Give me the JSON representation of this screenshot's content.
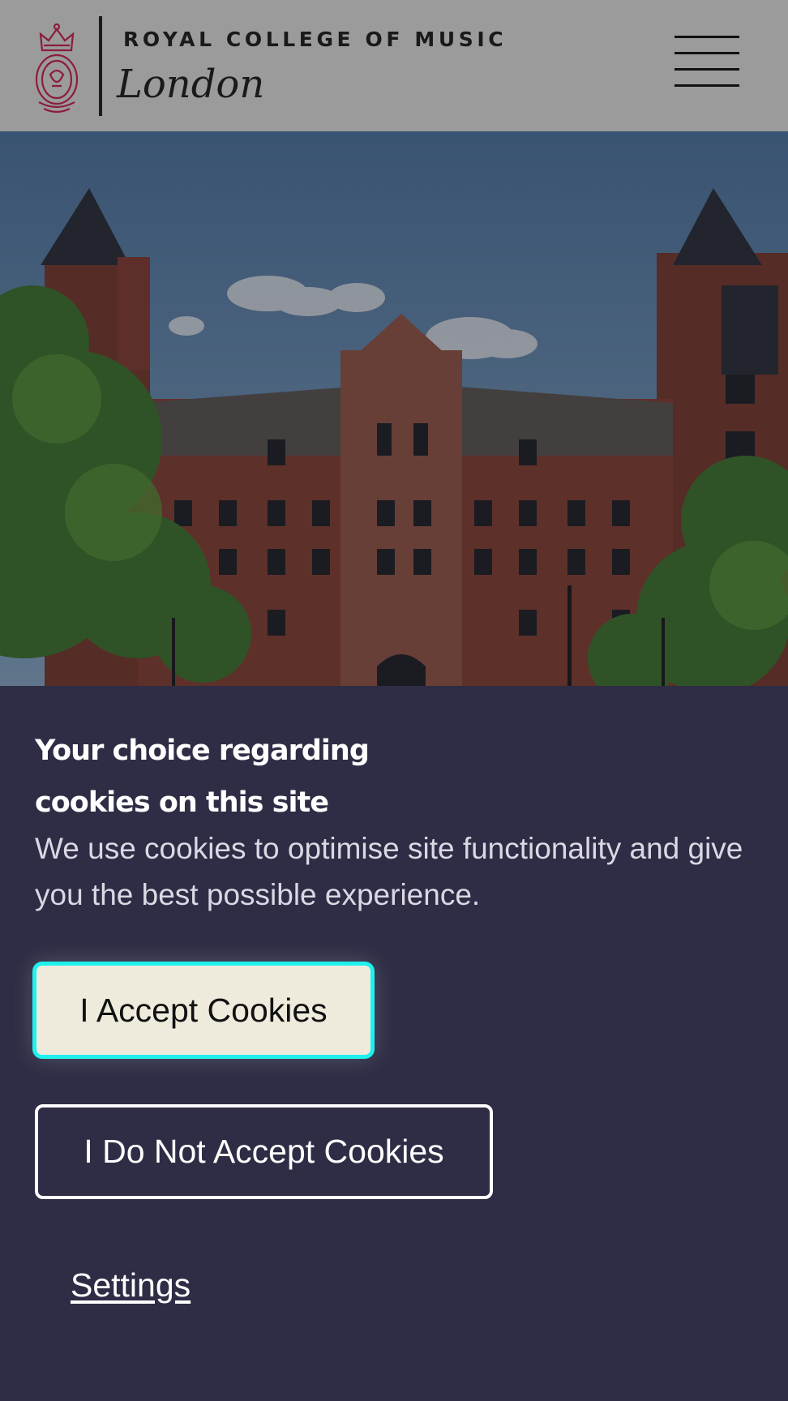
{
  "header": {
    "logo_title": "ROYAL COLLEGE OF MUSIC",
    "logo_subtitle": "London",
    "menu_icon": "hamburger-menu-icon",
    "crest_icon": "royal-crest-icon",
    "crest_color": "#8c1d3c"
  },
  "hero": {
    "image": "rcm-building-photo"
  },
  "cookie_banner": {
    "title": "Your choice regarding cookies on this site",
    "description": "We use cookies to optimise site functionality and give you the best possible experience.",
    "accept_label": "I Accept Cookies",
    "decline_label": "I Do Not Accept Cookies",
    "settings_label": "Settings",
    "colors": {
      "panel_bg": "#2e2d45",
      "accept_bg": "#eeebdc",
      "accept_focus_ring": "#1ff1ef"
    }
  }
}
